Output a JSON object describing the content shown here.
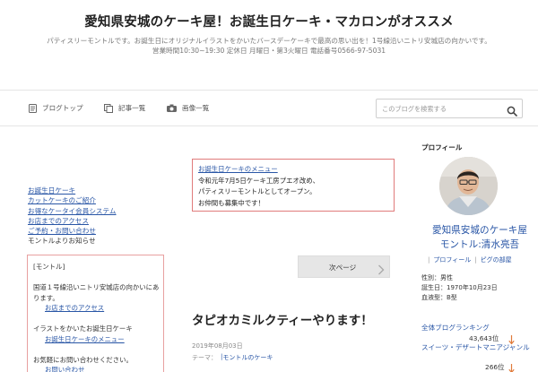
{
  "header": {
    "title": "愛知県安城のケーキ屋！お誕生日ケーキ・マカロンがオススメ",
    "description_line1": "パティスリーモントルです。お誕生日にオリジナルイラストをかいたバースデーケーキで最高の思い出を！1号線沿いニトリ安城店の向かいです。",
    "description_line2": "営業時間10:30~19:30 定休日 月曜日・第3火曜日 電話番号0566-97-5031"
  },
  "nav": {
    "items": [
      {
        "label": "ブログトップ",
        "icon": "document-icon"
      },
      {
        "label": "記事一覧",
        "icon": "copy-icon"
      },
      {
        "label": "画像一覧",
        "icon": "camera-icon"
      }
    ],
    "search_placeholder": "このブログを検索する"
  },
  "left_links": [
    "お誕生日ケーキ",
    "カットケーキのご紹介",
    "お得なケータイ会員システム",
    "お店までのアクセス",
    "ご予約・お問い合わせ"
  ],
  "left_plain": "モントルよりお知らせ",
  "info_box": {
    "heading": "[モントル]",
    "address_line1": "国道１号線沿いニトリ安城店の向かいにあ",
    "address_line2": "ります。",
    "access_link": "お店までのアクセス",
    "illust_text": "イラストをかいたお誕生日ケーキ",
    "menu_link": "お誕生日ケーキのメニュー",
    "contact_text": "お気軽にお問い合わせください。",
    "contact_link": "お問い合わせ"
  },
  "notice": {
    "link": "お誕生日ケーキのメニュー",
    "line1": "令和元年7月5日ケーキ工房プエオ改め、",
    "line2": "パティスリーモントルとしてオープン。",
    "line3": "お仲間も募集中です！"
  },
  "pager": {
    "next_label": "次ページ"
  },
  "post": {
    "title": "タピオカミルクティーやります！",
    "date": "2019年08月03日",
    "theme_label": "テーマ：",
    "theme_link": "モントルのケーキ"
  },
  "profile": {
    "heading": "プロフィール",
    "name_line1": "愛知県安城のケーキ屋",
    "name_line2": "モントル:清水亮吾",
    "link_profile": "プロフィール",
    "link_pigg": "ピグの部屋",
    "gender": "性別：男性",
    "birthday": "誕生日：1970年10月23日",
    "blood_type": "血液型：B型"
  },
  "rankings": [
    {
      "label": "全体ブログランキング",
      "value": "43,643位"
    },
    {
      "label": "スイーツ・デザートマニアジャンル",
      "value": "266位"
    }
  ],
  "colors": {
    "link": "#2956a6",
    "box_border": "#e07b7b",
    "rank_arrow": "#e07a3a"
  }
}
